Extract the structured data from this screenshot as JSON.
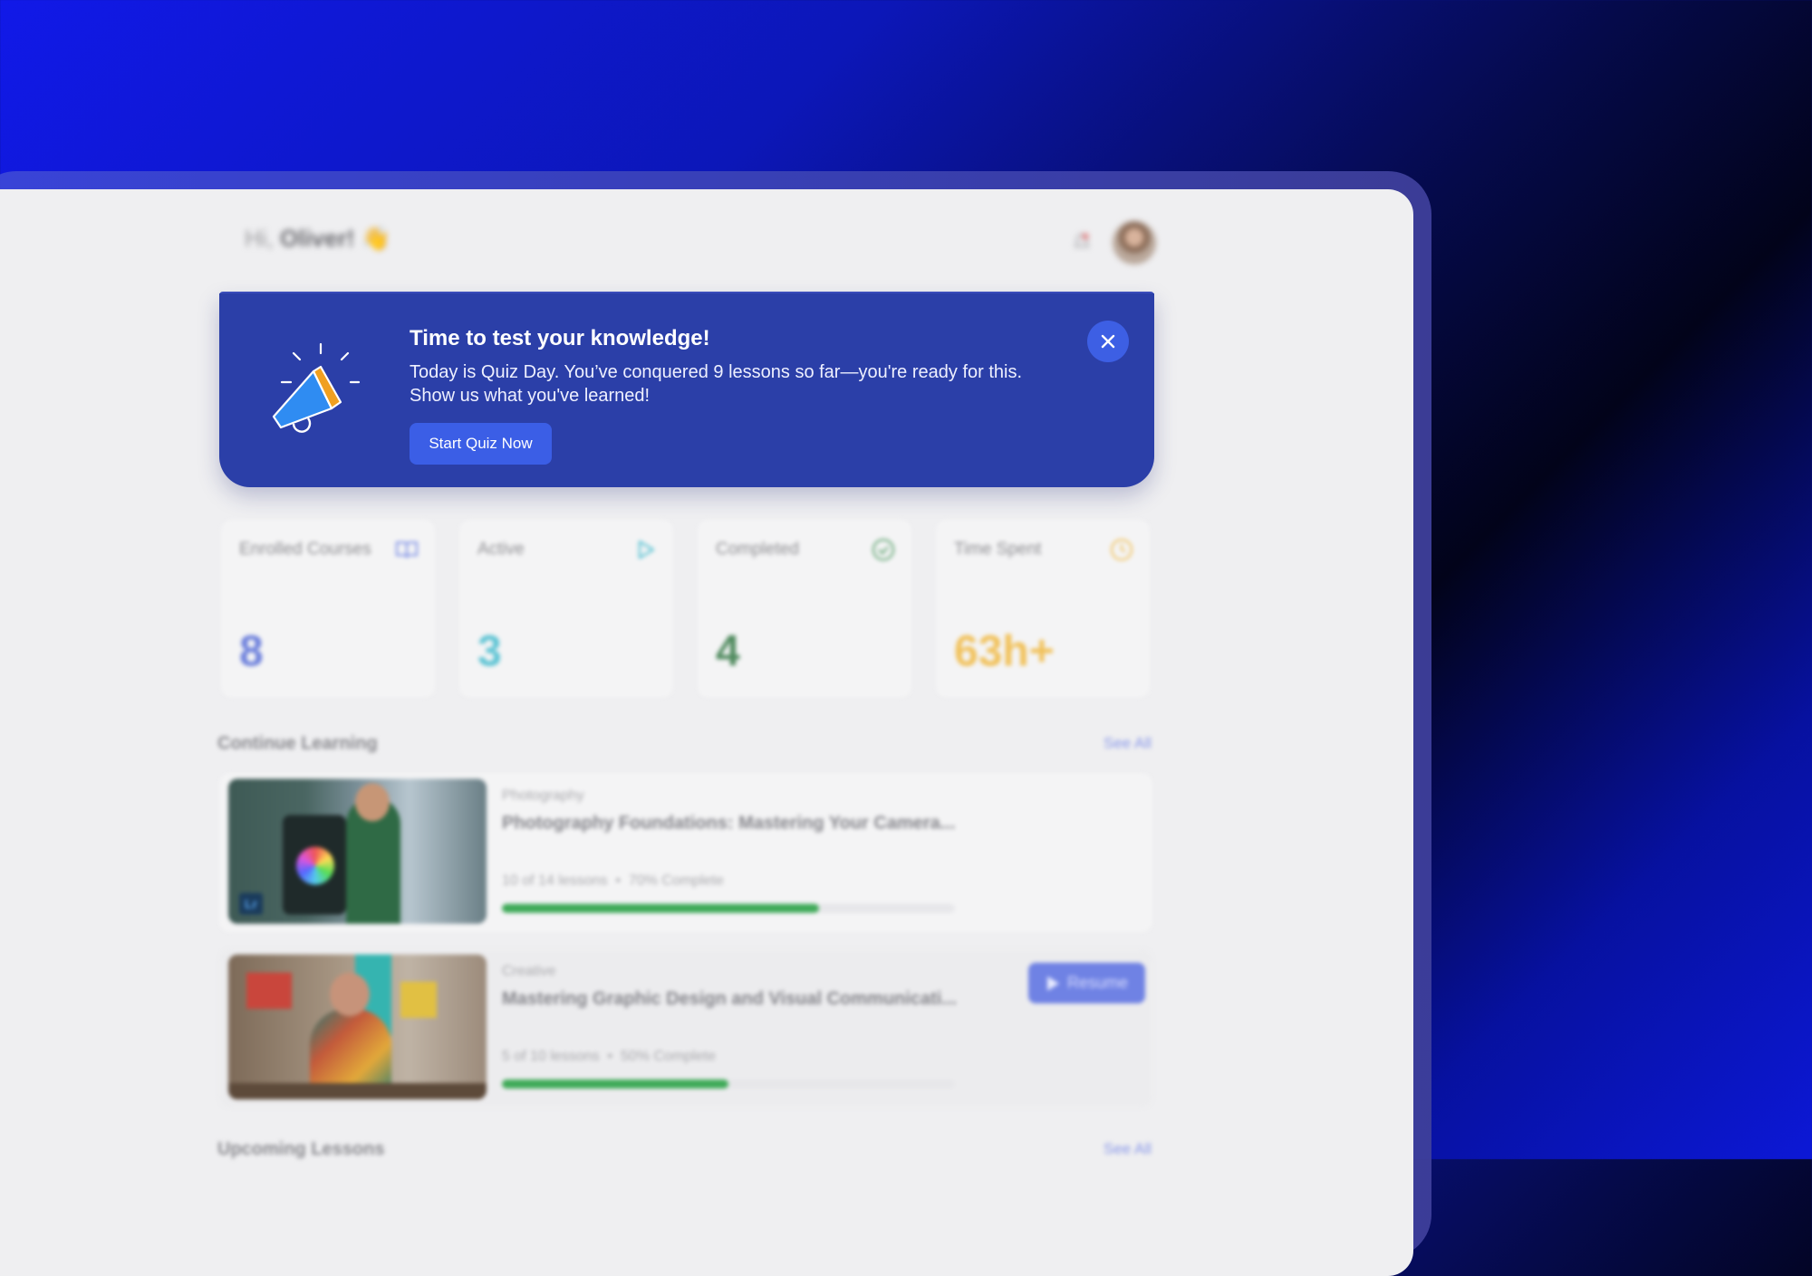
{
  "header": {
    "greeting": "Hi,",
    "user_name": "Oliver!",
    "wave_emoji": "👋",
    "icons": {
      "notification": "bell-icon",
      "avatar": "user-avatar"
    }
  },
  "banner": {
    "title": "Time to test your knowledge!",
    "text": "Today is Quiz Day. You’ve conquered 9 lessons so far—you're ready for this. Show us what you've learned!",
    "button_label": "Start Quiz Now",
    "icons": {
      "illustration": "megaphone-icon",
      "close": "close-icon"
    },
    "colors": {
      "background": "#2b3fa8",
      "button": "#3b5ee6"
    }
  },
  "stats": [
    {
      "label": "Enrolled Courses",
      "value": "8",
      "icon": "book-icon",
      "color": "#6d80dc"
    },
    {
      "label": "Active",
      "value": "3",
      "icon": "play-icon",
      "color": "#5ec4d4"
    },
    {
      "label": "Completed",
      "value": "4",
      "icon": "check-circle-icon",
      "color": "#4f8a5e"
    },
    {
      "label": "Time Spent",
      "value": "63h+",
      "icon": "clock-icon",
      "color": "#f1c15a"
    }
  ],
  "continue_learning": {
    "title": "Continue Learning",
    "see_all": "See All",
    "courses": [
      {
        "category": "Photography",
        "title": "Photography Foundations: Mastering Your Camera...",
        "lessons": "10 of 14 lessons",
        "separator": "•",
        "complete": "70% Complete",
        "progress": 0.7,
        "thumb_badge": "Lr"
      },
      {
        "category": "Creative",
        "title": "Mastering Graphic Design and Visual Communicati...",
        "lessons": "5 of 10 lessons",
        "separator": "•",
        "complete": "50% Complete",
        "progress": 0.5,
        "resume_label": "Resume"
      }
    ]
  },
  "upcoming": {
    "title": "Upcoming Lessons",
    "see_all": "See All"
  }
}
